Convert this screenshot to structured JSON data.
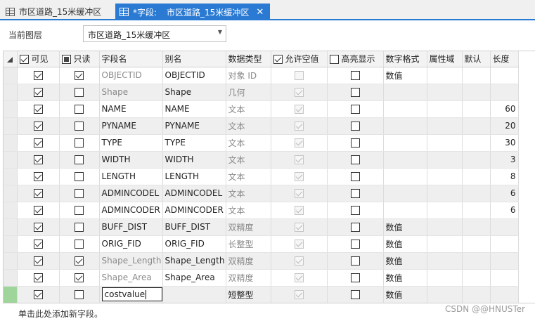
{
  "tabs": [
    {
      "label": "市区道路_15米缓冲区",
      "icon": "table-icon",
      "active": false
    },
    {
      "prefix": "*字段:",
      "label": "市区道路_15米缓冲区",
      "icon": "fields-table-icon",
      "close": "✕",
      "active": true
    }
  ],
  "layer": {
    "label": "当前图层",
    "selected": "市区道路_15米缓冲区"
  },
  "columns": [
    "可见",
    "只读",
    "字段名",
    "别名",
    "数据类型",
    "允许空值",
    "高亮显示",
    "数字格式",
    "属性域",
    "默认",
    "长度"
  ],
  "header_checks": {
    "visible": "checked",
    "readonly": "partial",
    "allow_null": "checked",
    "highlight": "unchecked"
  },
  "rows": [
    {
      "visible": true,
      "readonly": true,
      "name": "OBJECTID",
      "alias": "OBJECTID",
      "type": "对象 ID",
      "null": false,
      "highlight": false,
      "numfmt": "数值",
      "domain": "",
      "default": "",
      "length": "",
      "muted": true,
      "gray": false
    },
    {
      "visible": true,
      "readonly": false,
      "name": "Shape",
      "alias": "Shape",
      "type": "几何",
      "null": true,
      "highlight": false,
      "numfmt": "",
      "domain": "",
      "default": "",
      "length": "",
      "muted": true,
      "gray": true
    },
    {
      "visible": true,
      "readonly": false,
      "name": "NAME",
      "alias": "NAME",
      "type": "文本",
      "null": true,
      "highlight": false,
      "numfmt": "",
      "domain": "",
      "default": "",
      "length": "60",
      "muted": false,
      "gray": false
    },
    {
      "visible": true,
      "readonly": false,
      "name": "PYNAME",
      "alias": "PYNAME",
      "type": "文本",
      "null": true,
      "highlight": false,
      "numfmt": "",
      "domain": "",
      "default": "",
      "length": "20",
      "muted": false,
      "gray": true
    },
    {
      "visible": true,
      "readonly": false,
      "name": "TYPE",
      "alias": "TYPE",
      "type": "文本",
      "null": true,
      "highlight": false,
      "numfmt": "",
      "domain": "",
      "default": "",
      "length": "30",
      "muted": false,
      "gray": false
    },
    {
      "visible": true,
      "readonly": false,
      "name": "WIDTH",
      "alias": "WIDTH",
      "type": "文本",
      "null": true,
      "highlight": false,
      "numfmt": "",
      "domain": "",
      "default": "",
      "length": "3",
      "muted": false,
      "gray": true
    },
    {
      "visible": true,
      "readonly": false,
      "name": "LENGTH",
      "alias": "LENGTH",
      "type": "文本",
      "null": true,
      "highlight": false,
      "numfmt": "",
      "domain": "",
      "default": "",
      "length": "8",
      "muted": false,
      "gray": false
    },
    {
      "visible": true,
      "readonly": false,
      "name": "ADMINCODEL",
      "alias": "ADMINCODEL",
      "type": "文本",
      "null": true,
      "highlight": false,
      "numfmt": "",
      "domain": "",
      "default": "",
      "length": "6",
      "muted": false,
      "gray": true
    },
    {
      "visible": true,
      "readonly": false,
      "name": "ADMINCODER",
      "alias": "ADMINCODER",
      "type": "文本",
      "null": true,
      "highlight": false,
      "numfmt": "",
      "domain": "",
      "default": "",
      "length": "6",
      "muted": false,
      "gray": false
    },
    {
      "visible": true,
      "readonly": false,
      "name": "BUFF_DIST",
      "alias": "BUFF_DIST",
      "type": "双精度",
      "null": true,
      "highlight": false,
      "numfmt": "数值",
      "domain": "",
      "default": "",
      "length": "",
      "muted": false,
      "gray": true
    },
    {
      "visible": true,
      "readonly": false,
      "name": "ORIG_FID",
      "alias": "ORIG_FID",
      "type": "长整型",
      "null": true,
      "highlight": false,
      "numfmt": "数值",
      "domain": "",
      "default": "",
      "length": "",
      "muted": false,
      "gray": false
    },
    {
      "visible": true,
      "readonly": true,
      "name": "Shape_Length",
      "alias": "Shape_Length",
      "type": "双精度",
      "null": true,
      "highlight": false,
      "numfmt": "数值",
      "domain": "",
      "default": "",
      "length": "",
      "muted": true,
      "gray": true
    },
    {
      "visible": true,
      "readonly": true,
      "name": "Shape_Area",
      "alias": "Shape_Area",
      "type": "双精度",
      "null": true,
      "highlight": false,
      "numfmt": "数值",
      "domain": "",
      "default": "",
      "length": "",
      "muted": true,
      "gray": false
    }
  ],
  "new_row": {
    "visible": true,
    "readonly": false,
    "name": "costvalue",
    "alias": "",
    "type": "短整型",
    "null": true,
    "highlight": false,
    "numfmt": "数值"
  },
  "footer": {
    "add_hint": "单击此处添加新字段。",
    "watermark": "CSDN @@HNUSTer"
  }
}
